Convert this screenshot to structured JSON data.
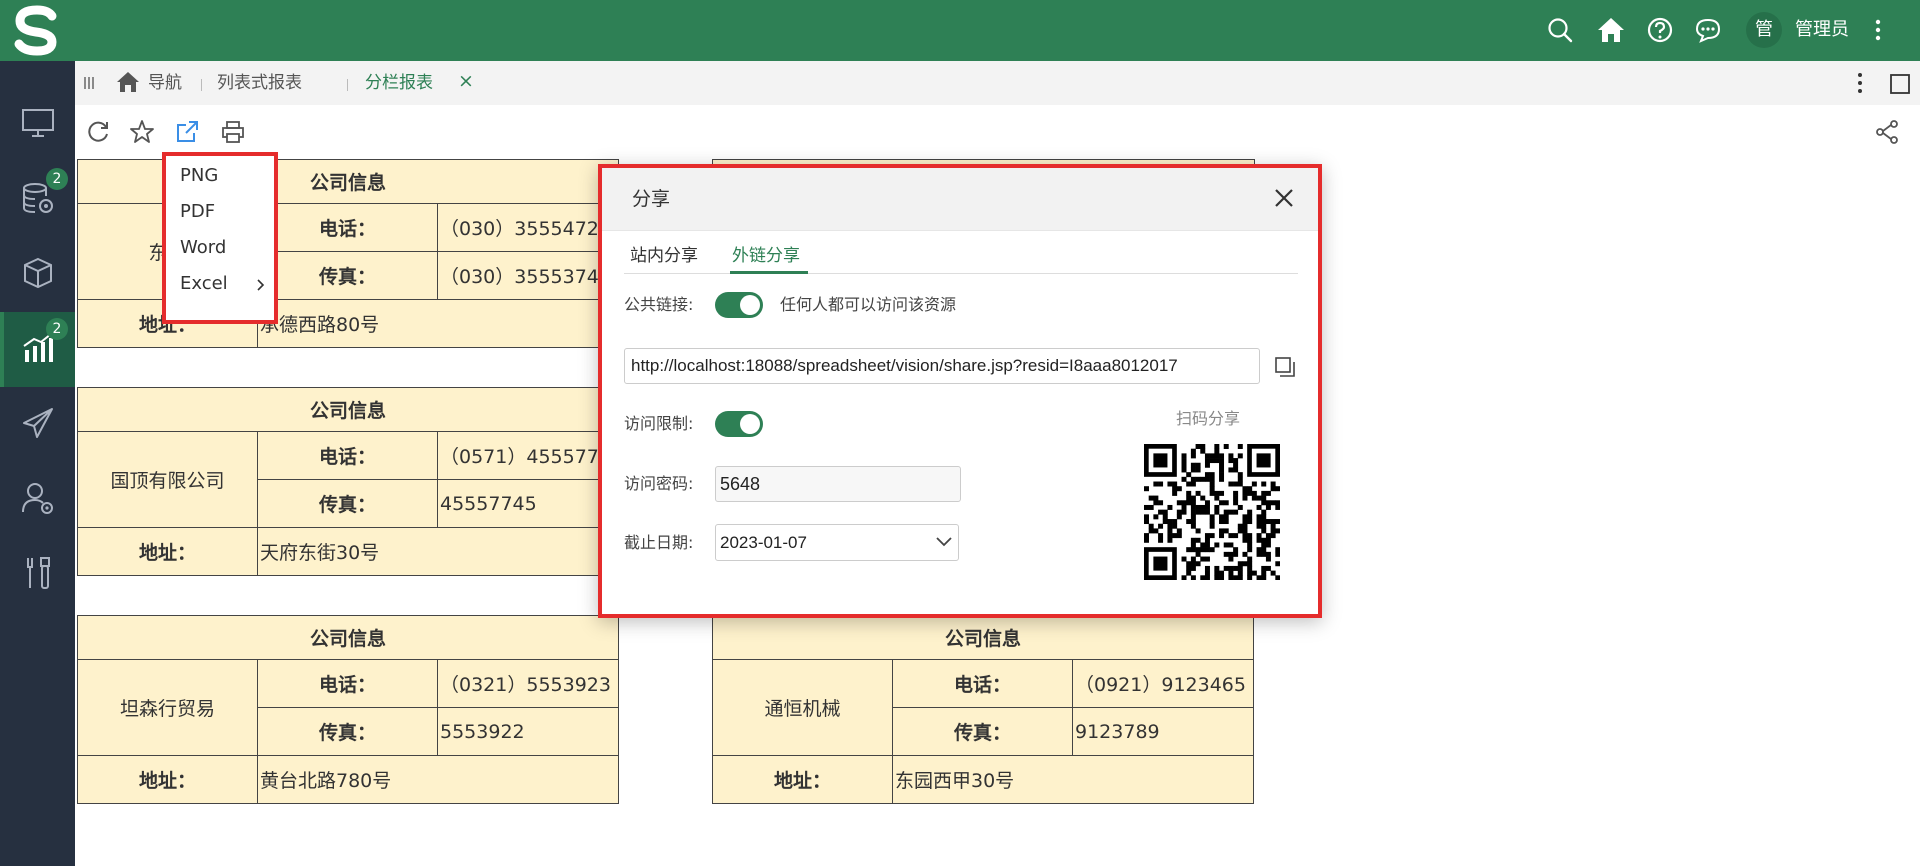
{
  "header": {
    "username": "管理员",
    "avatar_text": "管"
  },
  "icons": [
    "logo-s-icon",
    "search-icon",
    "home-icon",
    "help-icon",
    "chat-icon",
    "more-vertical-icon",
    "monitor-icon",
    "database-gear-icon",
    "cube-icon",
    "chart-icon",
    "send-icon",
    "person-gear-icon",
    "tools-icon",
    "refresh-icon",
    "star-icon",
    "export-icon",
    "print-icon",
    "share-icon",
    "fullscreen-icon",
    "copy-icon",
    "close-icon",
    "chevron-down-icon",
    "chevron-right-icon",
    "qr-code-icon"
  ],
  "colors": {
    "brand": "#2e8055",
    "sidebar": "#263040",
    "highlight": "#e52c2c",
    "cell": "#fef2cc"
  },
  "sidebar": {
    "badge_db": "2",
    "badge_chart": "2"
  },
  "tabs": {
    "nav": "导航",
    "list_report": "列表式报表",
    "column_report": "分栏报表",
    "close": "×"
  },
  "export_menu": {
    "png": "PNG",
    "pdf": "PDF",
    "word": "Word",
    "excel": "Excel"
  },
  "report": {
    "header": "公司信息",
    "phone_label": "电话：",
    "fax_label": "传真：",
    "address_label": "地址：",
    "companies": [
      {
        "name": "东南",
        "phone": "（030）3555472",
        "fax": "（030）3555374",
        "address": "承德西路80号"
      },
      {
        "name": "国顶有限公司",
        "phone": "（0571）455577",
        "fax": "45557745",
        "address": "天府东街30号"
      },
      {
        "name": "坦森行贸易",
        "phone": "（0321）5553923",
        "fax": "5553922",
        "address": "黄台北路780号"
      },
      {
        "name": "通恒机械",
        "phone": "（0921）9123465",
        "fax": "9123789",
        "address": "东园西甲30号"
      }
    ]
  },
  "dialog": {
    "title": "分享",
    "tab_internal": "站内分享",
    "tab_external": "外链分享",
    "public_link_label": "公共链接:",
    "public_link_desc": "任何人都可以访问该资源",
    "url": "http://localhost:18088/spreadsheet/vision/share.jsp?resid=I8aaa8012017",
    "access_limit_label": "访问限制:",
    "password_label": "访问密码:",
    "password": "5648",
    "deadline_label": "截止日期:",
    "deadline": "2023-01-07",
    "qr_label": "扫码分享",
    "public_link_on": true,
    "access_limit_on": true
  }
}
